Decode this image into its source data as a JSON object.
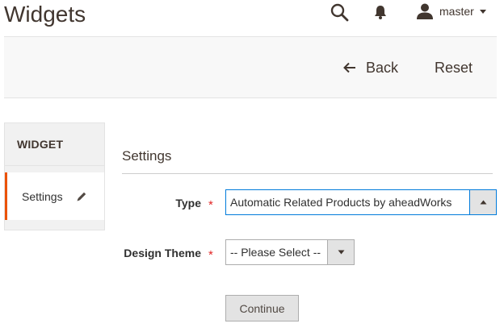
{
  "header": {
    "title": "Widgets",
    "user": {
      "name": "master"
    },
    "icons": [
      "search-icon",
      "bell-icon",
      "user-icon",
      "caret-down-icon"
    ]
  },
  "actions": {
    "back_label": "Back",
    "reset_label": "Reset"
  },
  "sidebar": {
    "title": "WIDGET",
    "items": [
      {
        "label": "Settings",
        "active": true,
        "icon": "pencil-icon"
      }
    ]
  },
  "main": {
    "section_title": "Settings",
    "fields": {
      "type": {
        "label": "Type",
        "required_mark": "*",
        "selected_value": "Automatic Related Products by aheadWorks"
      },
      "design_theme": {
        "label": "Design Theme",
        "required_mark": "*",
        "selected_value": "-- Please Select --"
      }
    },
    "continue_label": "Continue"
  },
  "colors": {
    "accent_orange": "#eb5202",
    "required_red": "#e22626",
    "focus_blue": "#007bdb",
    "text_dark": "#41362f"
  }
}
